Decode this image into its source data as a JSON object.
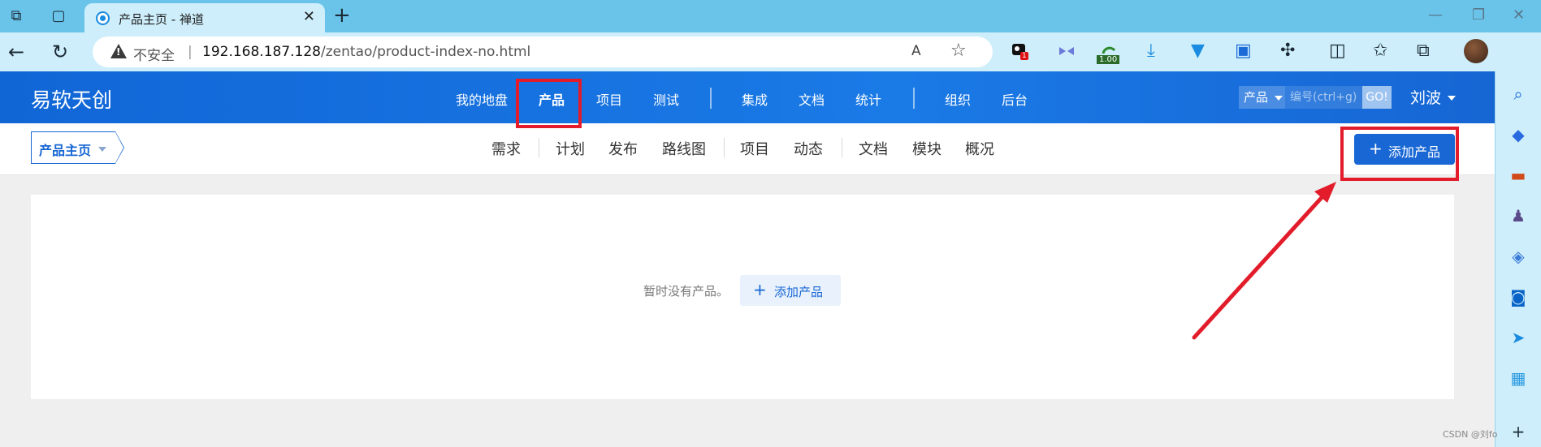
{
  "browser": {
    "tab_title": "产品主页 - 禅道",
    "tab_close": "✕",
    "new_tab": "+",
    "insecure_label": "不安全",
    "separator": "|",
    "url_host": "192.168.187.128",
    "url_path": "/zentao/product-index-no.html",
    "read_aloud": "A",
    "extension_badge": "1",
    "extension_value": "1.00"
  },
  "app": {
    "logo": "易软天创",
    "nav": [
      "我的地盘",
      "产品",
      "项目",
      "测试",
      "集成",
      "文档",
      "统计",
      "组织",
      "后台"
    ],
    "active_nav": "产品",
    "search": {
      "type_label": "产品",
      "placeholder": "编号(ctrl+g)",
      "go_label": "GO!"
    },
    "user_name": "刘波"
  },
  "subnav": {
    "crumb": "产品主页",
    "items": [
      "需求",
      "计划",
      "发布",
      "路线图",
      "项目",
      "动态",
      "文档",
      "模块",
      "概况"
    ],
    "add_button": "添加产品"
  },
  "main": {
    "empty_text": "暂时没有产品。",
    "add_button": "添加产品"
  },
  "watermark": "CSDN @刘fo",
  "colors": {
    "brand_blue": "#1867d4",
    "highlight_red": "#e21c2a",
    "tab_strip": "#6ac4ea"
  },
  "icons": [
    "workspaces-icon",
    "tab-actions-icon",
    "back-icon",
    "refresh-icon",
    "warning-icon",
    "read-aloud-icon",
    "favorite-star-icon",
    "split-screen-icon",
    "favorites-icon",
    "collections-icon",
    "search-icon",
    "shopping-icon",
    "toolbox-icon",
    "games-icon",
    "copilot-icon",
    "outlook-icon",
    "send-icon",
    "image-icon",
    "add-icon"
  ]
}
